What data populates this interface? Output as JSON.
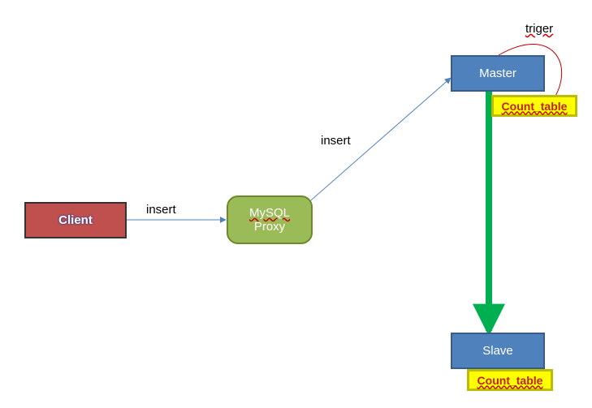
{
  "nodes": {
    "client": {
      "label": "Client"
    },
    "proxy": {
      "label_top": "MySQL",
      "label_bottom": "Proxy"
    },
    "master": {
      "label": "Master"
    },
    "slave": {
      "label": "Slave"
    },
    "count_master": {
      "label": "Count_table"
    },
    "count_slave": {
      "label": "Count_table"
    }
  },
  "edges": {
    "client_to_proxy": {
      "label": "insert"
    },
    "proxy_to_master": {
      "label": "insert"
    },
    "master_trigger": {
      "label": "triger"
    },
    "master_to_slave": {
      "label": ""
    }
  },
  "colors": {
    "client_bg": "#c0504d",
    "proxy_bg": "#9bbb59",
    "node_bg": "#4f81bd",
    "count_bg": "#ffff00",
    "thin_arrow": "#4f81bd",
    "thick_arrow": "#00b050",
    "curve_arrow": "#c00000"
  },
  "chart_data": {
    "type": "diagram",
    "title": "",
    "nodes": [
      {
        "id": "client",
        "label": "Client",
        "kind": "client"
      },
      {
        "id": "proxy",
        "label": "MySQL Proxy",
        "kind": "proxy"
      },
      {
        "id": "master",
        "label": "Master",
        "kind": "db-master"
      },
      {
        "id": "slave",
        "label": "Slave",
        "kind": "db-slave"
      },
      {
        "id": "count_master",
        "label": "Count_table",
        "kind": "table",
        "attached_to": "master"
      },
      {
        "id": "count_slave",
        "label": "Count_table",
        "kind": "table",
        "attached_to": "slave"
      }
    ],
    "edges": [
      {
        "from": "client",
        "to": "proxy",
        "label": "insert",
        "style": "thin-blue-arrow"
      },
      {
        "from": "proxy",
        "to": "master",
        "label": "insert",
        "style": "thin-blue-arrow"
      },
      {
        "from": "master",
        "to": "count_master",
        "label": "triger",
        "style": "red-curve-arrow"
      },
      {
        "from": "master",
        "to": "slave",
        "label": "",
        "style": "thick-green-arrow"
      }
    ]
  }
}
